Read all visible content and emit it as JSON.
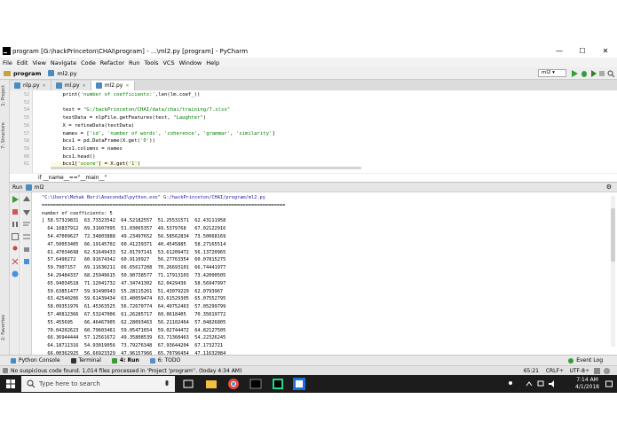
{
  "window": {
    "title": "program [G:\\hackPrinceton\\CHAI\\program] - ...\\ml2.py [program] - PyCharm",
    "controls": [
      "—",
      "☐",
      "✕"
    ]
  },
  "menu": [
    "File",
    "Edit",
    "View",
    "Navigate",
    "Code",
    "Refactor",
    "Run",
    "Tools",
    "VCS",
    "Window",
    "Help"
  ],
  "nav": {
    "project": "program",
    "file": "ml2.py",
    "run_config": "ml2"
  },
  "left_tool": {
    "project": "1: Project",
    "structure": "7: Structure",
    "favorites": "2: Favorites"
  },
  "tabs": [
    {
      "label": "nlp.py",
      "active": false
    },
    {
      "label": "ml.py",
      "active": false
    },
    {
      "label": "ml2.py",
      "active": true
    }
  ],
  "editor": {
    "lines": [
      {
        "n": "52",
        "code": "    print('number of coefficients:',len(lm.coef_))"
      },
      {
        "n": "53",
        "code": ""
      },
      {
        "n": "54",
        "code": "    test = \"G:/hackPrinceton/CHAI/data/chai/training/7.xlsx\""
      },
      {
        "n": "55",
        "code": "    testData = nlpFile.getFeatures(test, \"Laughter\")"
      },
      {
        "n": "56",
        "code": "    X = refineData(testData)"
      },
      {
        "n": "57",
        "code": "    names = ['id', 'number of words', 'coherence', 'grammar', 'similarity']"
      },
      {
        "n": "58",
        "code": "    bcs1 = pd.DataFrame(X.get('0'))"
      },
      {
        "n": "59",
        "code": "    bcs1.columns = names"
      },
      {
        "n": "60",
        "code": "    bcs1.head()"
      },
      {
        "n": "61",
        "code": "    bcs1['score'] = X.get('1')"
      }
    ],
    "breadcrumb": "if __name__==\"__main__\""
  },
  "run": {
    "header": "Run",
    "config": "ml2",
    "lines": [
      "\"C:\\Users\\Mehak Beri\\Anaconda3\\python.exe\" G:/hackPrinceton/CHAI/program/ml2.py",
      "======================================================================================",
      "number of coefficients: 5",
      "[ 58.57319831  63.73323542  64.52182557  51.25531571  62.43111958",
      "  64.16837912  69.31607095  51.03065357  49.5379768   67.02122916",
      "  54.47009627  72.34803888  49.23497652  56.58562834  73.50068169",
      "  47.50053405  66.19145702  60.41239371  40.4545885   58.27165514",
      "  61.47034698  62.51649433  52.01797141  53.61209472  56.13720965",
      "  57.6490272   60.91674342  60.9110927   56.27763354  60.07815275",
      "  59.7907157   69.11630211  66.65617208  70.26693101  66.74441977",
      "  54.29484337  68.25949615  50.90738577  71.17913103  73.42000505",
      "  65.94034518  71.12041732  47.34741302  62.0429436   58.56947997",
      "  59.63851477  59.91490943  55.28115261  51.43079229  62.0793967",
      "  63.42540206  59.61439434  63.40059474  63.61529305  65.07552795",
      "  58.09351976  61.45363525  56.72670774  64.49752463  57.05299799",
      "  57.40812366  67.53247006  61.26285717  60.0618405   70.35019772",
      "  55.455695    66.46467905  62.28093463  56.21102464  57.04826805",
      "  70.04202623  60.79603461  59.05471654  59.02744472  64.82127505",
      "  66.36944444  57.12561672  49.35808539  63.71360463  54.22326245",
      "  64.18711316  54.93019056  73.79276348  67.93644204  67.1732721",
      "  66.00362925  56.66923329  47.96157966  65.70796454  47.11632084"
    ]
  },
  "bottom_tabs": [
    "Python Console",
    "Terminal",
    "4: Run",
    "6: TODO"
  ],
  "event_log": "Event Log",
  "status": {
    "message": "No suspicious code found. 1,014 files processed in 'Project 'program''. (today 4:34 AM)",
    "position": "65:21",
    "line_sep": "CRLF÷",
    "encoding": "UTF-8÷"
  },
  "taskbar": {
    "search_placeholder": "Type here to search",
    "time": "7:14 AM",
    "date": "4/1/2018"
  },
  "colors": {
    "editor_bg": "#ffffff",
    "string": "#008000",
    "run_green": "#3a9a3a",
    "taskbar_bg": "#1c1c1c"
  }
}
